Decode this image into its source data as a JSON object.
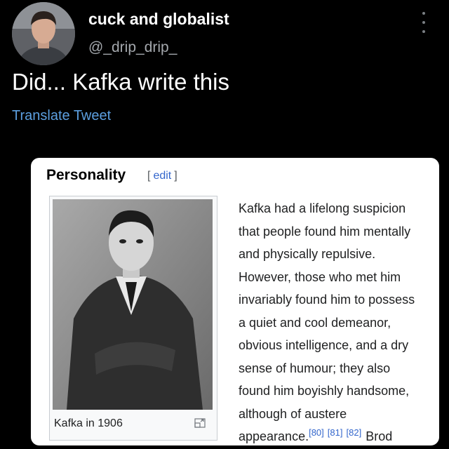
{
  "tweet": {
    "display_name": "cuck and globalist",
    "handle": "@_drip_drip_",
    "text": "Did... Kafka write this",
    "translate_label": "Translate Tweet"
  },
  "wiki": {
    "section_title": "Personality",
    "edit_open": "[",
    "edit_label": "edit",
    "edit_close": "]",
    "caption": "Kafka in 1906",
    "lines": [
      "Kafka had a lifelong suspicion",
      "that people found him mentally",
      "and physically repulsive.",
      "However, those who met him",
      "invariably found him to possess",
      "a quiet and cool demeanor,",
      "obvious intelligence, and a dry",
      "sense of humour; they also",
      "found him boyishly handsome,",
      "although of austere"
    ],
    "last_line_text": "appearance.",
    "refs": [
      "[80]",
      "[81]",
      "[82]"
    ],
    "trailing_text": "Brod"
  },
  "icons": {
    "more": "more-options-icon",
    "magnify": "enlarge-icon"
  }
}
